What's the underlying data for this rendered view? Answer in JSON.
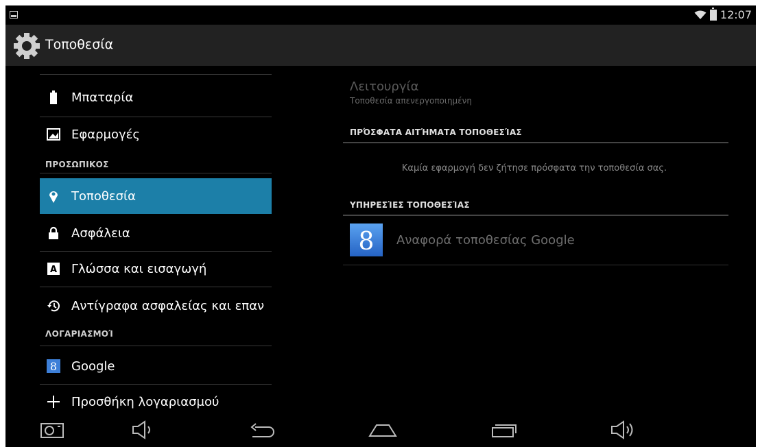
{
  "status_bar": {
    "time": "12:07"
  },
  "action_bar": {
    "title": "Τοποθεσία"
  },
  "sidebar": {
    "items": [
      {
        "label": "Μπαταρία",
        "icon": "battery-icon"
      },
      {
        "label": "Εφαρμογές",
        "icon": "apps-icon"
      }
    ],
    "section_personal": "ΠΡΟΣΩΠΙΚΟΣ",
    "personal_items": [
      {
        "label": "Τοποθεσία",
        "icon": "location-pin-icon",
        "selected": true
      },
      {
        "label": "Ασφάλεια",
        "icon": "lock-icon"
      },
      {
        "label": "Γλώσσα και εισαγωγή",
        "icon": "language-icon"
      },
      {
        "label": "Αντίγραφα ασφαλείας και επαν",
        "icon": "backup-restore-icon"
      }
    ],
    "section_accounts": "ΛΟΓΑΡΙΑΣΜΟΊ",
    "account_items": [
      {
        "label": "Google",
        "icon": "google-icon"
      },
      {
        "label": "Προσθήκη λογαριασμού",
        "icon": "plus-icon"
      }
    ]
  },
  "main": {
    "mode_title": "Λειτουργία",
    "mode_subtitle": "Τοποθεσία απενεργοποιημένη",
    "recent_requests_header": "ΠΡΌΣΦΑΤΑ ΑΙΤΉΜΑΤΑ ΤΟΠΟΘΕΣΊΑΣ",
    "recent_requests_empty": "Καμία εφαρμογή δεν ζήτησε πρόσφατα την τοποθεσία σας.",
    "services_header": "ΥΠΗΡΕΣΊΕΣ ΤΟΠΟΘΕΣΊΑΣ",
    "services": [
      {
        "label": "Αναφορά τοποθεσίας Google",
        "icon": "google-icon"
      }
    ]
  },
  "nav_bar": {
    "buttons": [
      "screenshot-icon",
      "volume-down-icon",
      "back-icon",
      "home-icon",
      "recents-icon",
      "volume-up-icon"
    ]
  },
  "colors": {
    "accent": "#1c7fa8",
    "action_bar": "#222222",
    "background": "#000000"
  }
}
